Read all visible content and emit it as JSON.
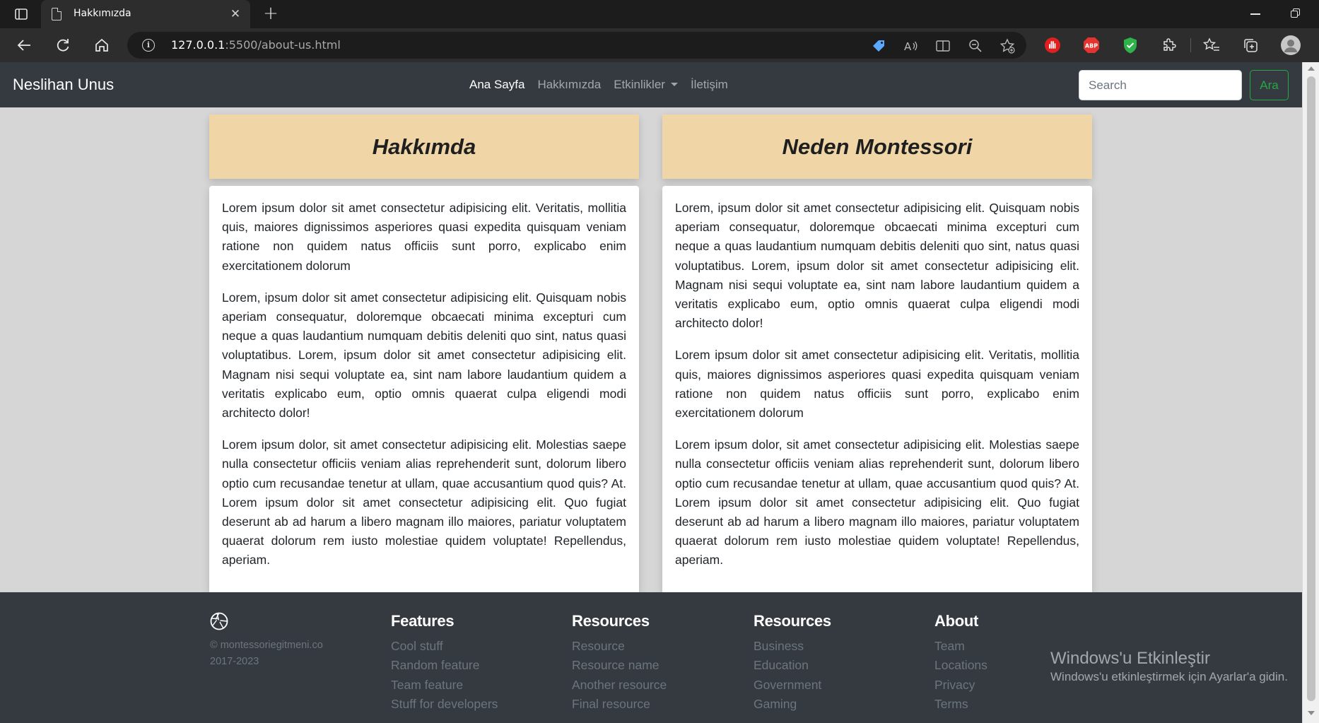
{
  "browser": {
    "tab_title": "Hakkımızda",
    "url_host": "127.0.0.1",
    "url_rest": ":5500/about-us.html"
  },
  "navbar": {
    "brand": "Neslihan Unus",
    "links": [
      "Ana Sayfa",
      "Hakkımızda",
      "Etkinlikler",
      "İletişim"
    ],
    "search_placeholder": "Search",
    "search_button": "Ara"
  },
  "cards": [
    {
      "title": "Hakkımda",
      "paragraphs": [
        "Lorem ipsum dolor sit amet consectetur adipisicing elit. Veritatis, mollitia quis, maiores dignissimos asperiores quasi expedita quisquam veniam ratione non quidem natus officiis sunt porro, explicabo enim exercitationem dolorum",
        "Lorem, ipsum dolor sit amet consectetur adipisicing elit. Quisquam nobis aperiam consequatur, doloremque obcaecati minima excepturi cum neque a quas laudantium numquam debitis deleniti quo sint, natus quasi voluptatibus. Lorem, ipsum dolor sit amet consectetur adipisicing elit. Magnam nisi sequi voluptate ea, sint nam labore laudantium quidem a veritatis explicabo eum, optio omnis quaerat culpa eligendi modi architecto dolor!",
        "Lorem ipsum dolor, sit amet consectetur adipisicing elit. Molestias saepe nulla consectetur officiis veniam alias reprehenderit sunt, dolorum libero optio cum recusandae tenetur at ullam, quae accusantium quod quis? At. Lorem ipsum dolor sit amet consectetur adipisicing elit. Quo fugiat deserunt ab ad harum a libero magnam illo maiores, pariatur voluptatem quaerat dolorum rem iusto molestiae quidem voluptate! Repellendus, aperiam."
      ]
    },
    {
      "title": "Neden Montessori",
      "paragraphs": [
        "Lorem, ipsum dolor sit amet consectetur adipisicing elit. Quisquam nobis aperiam consequatur, doloremque obcaecati minima excepturi cum neque a quas laudantium numquam debitis deleniti quo sint, natus quasi voluptatibus. Lorem, ipsum dolor sit amet consectetur adipisicing elit. Magnam nisi sequi voluptate ea, sint nam labore laudantium quidem a veritatis explicabo eum, optio omnis quaerat culpa eligendi modi architecto dolor!",
        "Lorem ipsum dolor sit amet consectetur adipisicing elit. Veritatis, mollitia quis, maiores dignissimos asperiores quasi expedita quisquam veniam ratione non quidem natus officiis sunt porro, explicabo enim exercitationem dolorum",
        "Lorem ipsum dolor, sit amet consectetur adipisicing elit. Molestias saepe nulla consectetur officiis veniam alias reprehenderit sunt, dolorum libero optio cum recusandae tenetur at ullam, quae accusantium quod quis? At. Lorem ipsum dolor sit amet consectetur adipisicing elit. Quo fugiat deserunt ab ad harum a libero magnam illo maiores, pariatur voluptatem quaerat dolorum rem iusto molestiae quidem voluptate! Repellendus, aperiam."
      ]
    }
  ],
  "footer": {
    "copyright_line1": "© montessoriegitmeni.co",
    "copyright_line2": "2017-2023",
    "columns": [
      {
        "heading": "Features",
        "links": [
          "Cool stuff",
          "Random feature",
          "Team feature",
          "Stuff for developers"
        ]
      },
      {
        "heading": "Resources",
        "links": [
          "Resource",
          "Resource name",
          "Another resource",
          "Final resource"
        ]
      },
      {
        "heading": "Resources",
        "links": [
          "Business",
          "Education",
          "Government",
          "Gaming"
        ]
      },
      {
        "heading": "About",
        "links": [
          "Team",
          "Locations",
          "Privacy",
          "Terms"
        ]
      }
    ]
  },
  "watermark": {
    "line1": "Windows'u Etkinleştir",
    "line2": "Windows'u etkinleştirmek için Ayarlar'a gidin."
  },
  "colors": {
    "navbar_bg": "#343a40",
    "card_header_bg": "#f0d6a6",
    "page_bg": "#d6d6d6",
    "search_button_accent": "#28a745"
  }
}
